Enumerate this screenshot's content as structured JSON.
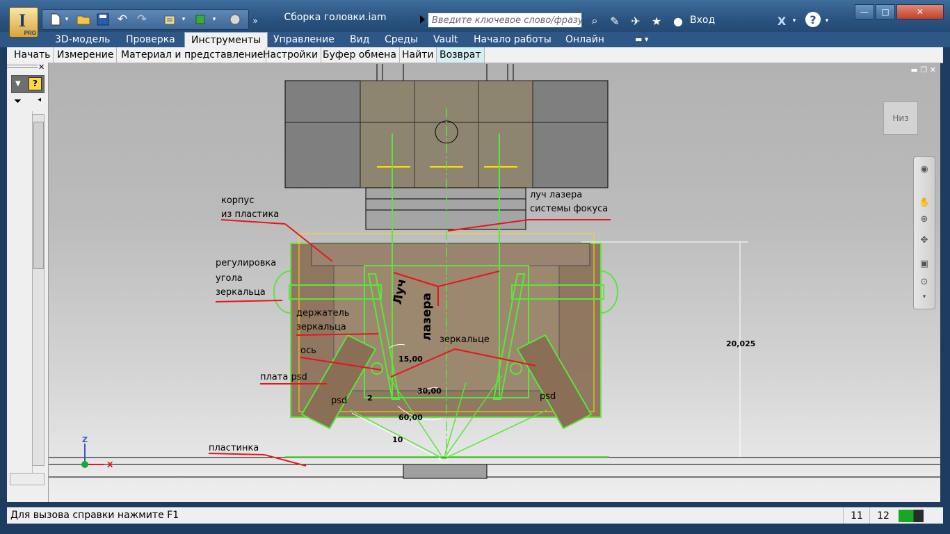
{
  "window": {
    "title": "Сборка головки.iam",
    "app_logo_text": "I",
    "app_badge": "PRO",
    "controls": {
      "minimize": "—",
      "maximize": "□",
      "close": "✕"
    }
  },
  "search": {
    "placeholder": "Введите ключевое слово/фразу"
  },
  "account": {
    "login_label": "Вход",
    "help_glyph": "?"
  },
  "ribbon": {
    "tabs": [
      {
        "label": "3D-модель"
      },
      {
        "label": "Проверка"
      },
      {
        "label": "Инструменты"
      },
      {
        "label": "Управление"
      },
      {
        "label": "Вид"
      },
      {
        "label": "Среды"
      },
      {
        "label": "Vault"
      },
      {
        "label": "Начало работы"
      },
      {
        "label": "Онлайн"
      }
    ],
    "active_tab": "Инструменты"
  },
  "panels": {
    "items": [
      {
        "label": "Начать"
      },
      {
        "label": "Измерение"
      },
      {
        "label": "Материал и представление"
      },
      {
        "label": "Настройки"
      },
      {
        "label": "Буфер обмена"
      },
      {
        "label": "Найти"
      },
      {
        "label": "Возврат"
      }
    ],
    "active_panel": "Возврат"
  },
  "viewcube": {
    "label": "Низ"
  },
  "annotations": {
    "housing_1": "корпус",
    "housing_2": "из пластика",
    "beam_1": "луч лазера",
    "beam_2": "системы фокуса",
    "angle_1": "регулировка",
    "angle_2": "угола",
    "angle_3": "зеркальца",
    "holder_1": "держатель",
    "holder_2": "зеркальца",
    "mirror": "зеркальце",
    "axis": "ось",
    "psd_board": "плата psd",
    "psd_left": "psd",
    "psd_right": "psd",
    "plate": "пластинка",
    "laser_beam_1": "Луч",
    "laser_beam_2": "лазера"
  },
  "dimensions": {
    "angle_15": "15,00",
    "angle_30": "30,00",
    "angle_60": "60,00",
    "dist_10": "10",
    "dist_2": "2",
    "height": "20,025"
  },
  "triad": {
    "z": "Z",
    "x": "X"
  },
  "status": {
    "help_text": "Для вызова справки нажмите F1",
    "count_a": "11",
    "count_b": "12"
  },
  "colors": {
    "accent_green": "#5ae63a",
    "annotation_red": "#e8141c",
    "part_brown": "#8a6e55",
    "titlebar_blue": "#2a5380"
  }
}
